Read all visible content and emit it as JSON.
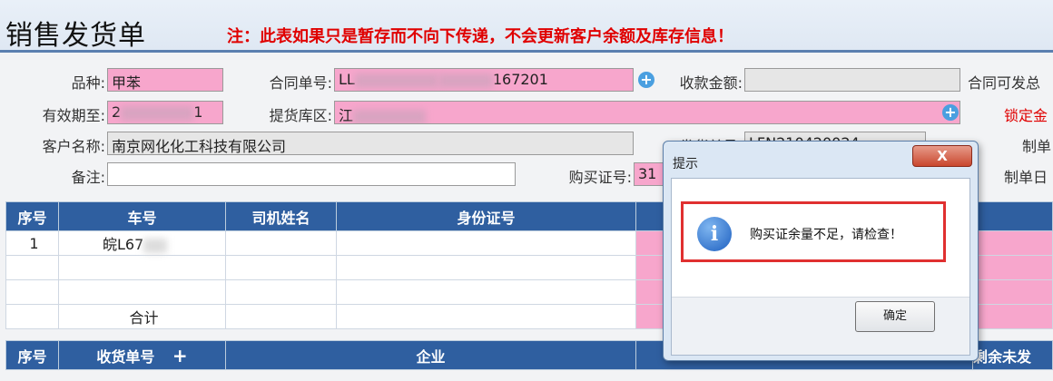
{
  "header": {
    "title": "销售发货单",
    "warning": "注：此表如果只是暂存而不向下传递，不会更新客户余额及库存信息！"
  },
  "form": {
    "variety_label": "品种:",
    "variety_value": "甲苯",
    "contract_no_label": "合同单号:",
    "contract_no_prefix": "LL",
    "contract_no_suffix": "167201",
    "receipt_amount_label": "收款金额:",
    "contract_shippable_label": "合同可发总",
    "valid_until_label": "有效期至:",
    "valid_until_prefix": "2",
    "valid_until_suffix": "1",
    "pickup_area_label": "提货库区:",
    "pickup_area_prefix": "江",
    "lock_label": "锁定金",
    "customer_label": "客户名称:",
    "customer_value": "南京网化化工科技有限公司",
    "ship_no_label": "发货单号:",
    "ship_no_value": "LFN210420024",
    "maker_label": "制单",
    "remark_label": "备注:",
    "purchase_cert_label": "购买证号:",
    "purchase_cert_value": "31",
    "make_date_label": "制单日"
  },
  "vehicle_table": {
    "headers": [
      "序号",
      "车号",
      "司机姓名",
      "身份证号"
    ],
    "rows": [
      {
        "no": "1",
        "plate": "皖L67"
      }
    ],
    "total_label": "合计"
  },
  "receipt_table": {
    "headers": [
      "序号",
      "收货单号",
      "企业",
      "剩余未发"
    ]
  },
  "dialog": {
    "title": "提示",
    "close": "X",
    "message": "购买证余量不足，请检查！",
    "ok": "确定"
  },
  "colors": {
    "header_blue": "#2f5fa0",
    "required_pink": "#f7a6cc",
    "warning_red": "#e00000"
  }
}
